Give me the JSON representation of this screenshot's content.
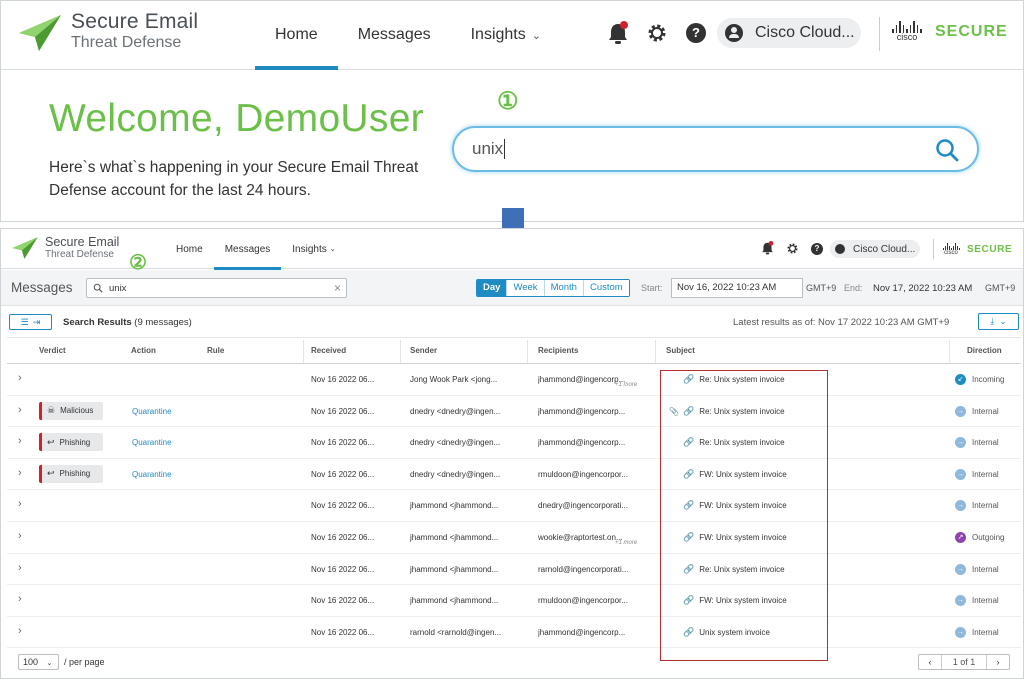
{
  "top": {
    "brand_line1": "Secure Email",
    "brand_line2": "Threat Defense",
    "nav": [
      {
        "label": "Home"
      },
      {
        "label": "Messages"
      },
      {
        "label": "Insights"
      }
    ],
    "account_name": "Cisco Cloud...",
    "cisco_word": "cisco",
    "secure_word": "SECURE",
    "welcome": "Welcome, DemoUser",
    "subtitle": "Here`s what`s happening in your Secure Email Threat Defense account for the last 24 hours.",
    "step_marker": "①",
    "search_value": "unix"
  },
  "bottom": {
    "brand_line1": "Secure Email",
    "brand_line2": "Threat Defense",
    "nav": [
      {
        "label": "Home"
      },
      {
        "label": "Messages"
      },
      {
        "label": "Insights"
      }
    ],
    "account_name": "Cisco Cloud...",
    "cisco_word": "cisco",
    "secure_word": "SECURE",
    "step_marker": "②",
    "page_title": "Messages",
    "search_value": "unix",
    "range_options": [
      "Day",
      "Week",
      "Month",
      "Custom"
    ],
    "range_selected": "Day",
    "start_label": "Start:",
    "start_value": "Nov 16, 2022 10:23 AM",
    "start_tz": "GMT+9",
    "end_label": "End:",
    "end_value": "Nov 17, 2022 10:23 AM",
    "end_tz": "GMT+9",
    "results_title": "Search Results",
    "results_count": "(9 messages)",
    "latest_results": "Latest results as of: Nov 17 2022 10:23 AM GMT+9",
    "columns": [
      "Verdict",
      "Action",
      "Rule",
      "Received",
      "Sender",
      "Recipients",
      "Subject",
      "Direction"
    ],
    "rows": [
      {
        "verdict": "",
        "action": "",
        "received": "Nov 16 2022 06...",
        "sender": "Jong Wook Park <jong...",
        "recipients": "jhammond@ingencorp...",
        "more": "+1 more",
        "attachment": false,
        "subject": "Re: Unix system invoice",
        "direction": "Incoming"
      },
      {
        "verdict": "Malicious",
        "action": "Quarantine",
        "received": "Nov 16 2022 06...",
        "sender": "dnedry <dnedry@ingen...",
        "recipients": "jhammond@ingencorp...",
        "more": "",
        "attachment": true,
        "subject": "Re: Unix system invoice",
        "direction": "Internal"
      },
      {
        "verdict": "Phishing",
        "action": "Quarantine",
        "received": "Nov 16 2022 06...",
        "sender": "dnedry <dnedry@ingen...",
        "recipients": "jhammond@ingencorp...",
        "more": "",
        "attachment": false,
        "subject": "Re: Unix system invoice",
        "direction": "Internal"
      },
      {
        "verdict": "Phishing",
        "action": "Quarantine",
        "received": "Nov 16 2022 06...",
        "sender": "dnedry <dnedry@ingen...",
        "recipients": "rmuldoon@ingencorpor...",
        "more": "",
        "attachment": false,
        "subject": "FW: Unix system invoice",
        "direction": "Internal"
      },
      {
        "verdict": "",
        "action": "",
        "received": "Nov 16 2022 06...",
        "sender": "jhammond <jhammond...",
        "recipients": "dnedry@ingencorporati...",
        "more": "",
        "attachment": false,
        "subject": "FW: Unix system invoice",
        "direction": "Internal"
      },
      {
        "verdict": "",
        "action": "",
        "received": "Nov 16 2022 06...",
        "sender": "jhammond <jhammond...",
        "recipients": "wookie@raptortest.on...",
        "more": "+1 more",
        "attachment": false,
        "subject": "FW: Unix system invoice",
        "direction": "Outgoing"
      },
      {
        "verdict": "",
        "action": "",
        "received": "Nov 16 2022 06...",
        "sender": "jhammond <jhammond...",
        "recipients": "rarnold@ingencorporati...",
        "more": "",
        "attachment": false,
        "subject": "Re: Unix system invoice",
        "direction": "Internal"
      },
      {
        "verdict": "",
        "action": "",
        "received": "Nov 16 2022 06...",
        "sender": "jhammond <jhammond...",
        "recipients": "rmuldoon@ingencorpor...",
        "more": "",
        "attachment": false,
        "subject": "FW: Unix system invoice",
        "direction": "Internal"
      },
      {
        "verdict": "",
        "action": "",
        "received": "Nov 16 2022 06...",
        "sender": "rarnold <rarnold@ingen...",
        "recipients": "jhammond@ingencorp...",
        "more": "",
        "attachment": false,
        "subject": "Unix system invoice",
        "direction": "Internal"
      }
    ],
    "page_size": "100",
    "per_page_label": "/ per page",
    "page_indicator": "1 of 1"
  },
  "colors": {
    "accent_green": "#6cc04a",
    "accent_blue": "#1e8bc3",
    "verdict_red": "#cf2030",
    "highlight_box": "#b03030",
    "arrow_blue": "#3f6fb6",
    "direction_incoming": "#1e8bc3",
    "direction_internal": "#8fb8dc",
    "direction_outgoing": "#8e44ad"
  }
}
